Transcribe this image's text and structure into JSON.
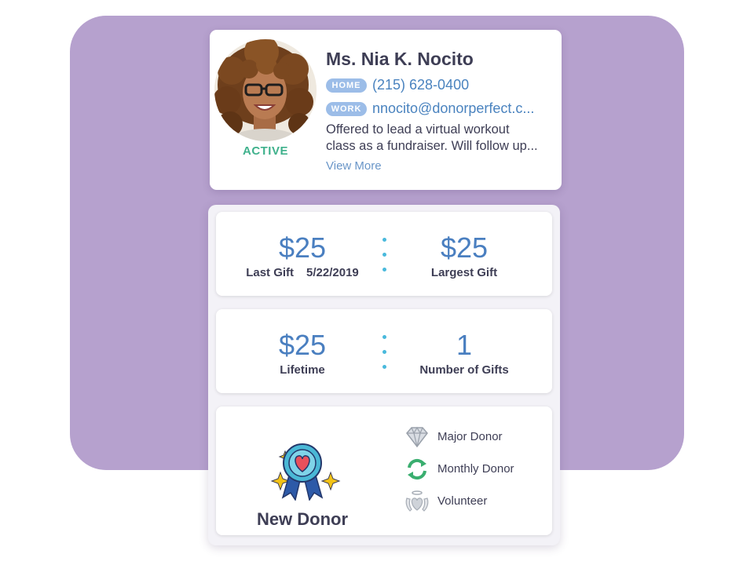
{
  "profile": {
    "name": "Ms. Nia K. Nocito",
    "status": "ACTIVE",
    "home_tag": "HOME",
    "home_phone": "(215) 628-0400",
    "work_tag": "WORK",
    "work_email": "nnocito@donorperfect.c...",
    "note_line1": "Offered to lead a virtual workout",
    "note_line2": "class as a fundraiser. Will follow up...",
    "view_more": "View More"
  },
  "stats": {
    "last_gift_value": "$25",
    "last_gift_label": "Last Gift",
    "last_gift_date": "5/22/2019",
    "largest_gift_value": "$25",
    "largest_gift_label": "Largest Gift",
    "lifetime_value": "$25",
    "lifetime_label": "Lifetime",
    "number_of_gifts_value": "1",
    "number_of_gifts_label": "Number of Gifts"
  },
  "badges": {
    "current": "New Donor",
    "types": [
      {
        "label": "Major Donor",
        "icon": "diamond-icon"
      },
      {
        "label": "Monthly Donor",
        "icon": "recurring-icon"
      },
      {
        "label": "Volunteer",
        "icon": "angel-heart-icon"
      }
    ]
  },
  "colors": {
    "background_panel": "#b6a1ce",
    "accent_blue": "#4a7fc0",
    "active_green": "#3fb18c",
    "tag_blue": "#9cbde8",
    "divider_cyan": "#49b9dc"
  }
}
